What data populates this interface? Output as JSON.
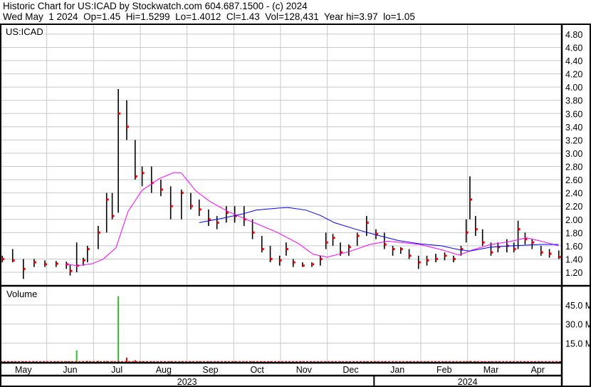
{
  "header": {
    "title": "Historic Chart for US:ICAD by Stockwatch.com 604.687.1500 - (c) 2024",
    "quote": "Wed May  1 2024  Op=1.45  Hi=1.5299  Lo=1.4012  Cl=1.43  Vol=128,431  Year hi=3.97  lo=1.05"
  },
  "colors": {
    "bar": "#000000",
    "close_tick": "#ff0000",
    "ma_short": "#ff00ff",
    "ma_long": "#0000ff",
    "vol_up": "#33bb33",
    "vol_down": "#ff0000",
    "grid": "#c8c8c8"
  },
  "chart_data": {
    "type": "ohlc",
    "symbol_label": "US:ICAD",
    "volume_label": "Volume",
    "x_unit": "months since May 1 2023",
    "xlim": [
      0,
      12
    ],
    "ylim": [
      1.0,
      4.95
    ],
    "yticks": [
      "1.20",
      "1.40",
      "1.60",
      "1.80",
      "2.00",
      "2.20",
      "2.40",
      "2.60",
      "2.80",
      "3.00",
      "3.20",
      "3.40",
      "3.60",
      "3.80",
      "4.00",
      "4.20",
      "4.40",
      "4.60",
      "4.80"
    ],
    "vol_ylim": [
      0,
      60
    ],
    "vol_ticks": [
      "15.0 M",
      "30.0 M",
      "45.0 M"
    ],
    "months": [
      "May",
      "Jun",
      "Jul",
      "Aug",
      "Sep",
      "Oct",
      "Nov",
      "Dec",
      "Jan",
      "Feb",
      "Mar",
      "Apr"
    ],
    "years": [
      {
        "label": "2023",
        "from": 0,
        "to": 8
      },
      {
        "label": "2024",
        "from": 8,
        "to": 12
      }
    ],
    "bars": [
      [
        0.05,
        1.45,
        1.35,
        1.4,
        0.5
      ],
      [
        0.27,
        1.55,
        1.35,
        1.38,
        0.6
      ],
      [
        0.5,
        1.4,
        1.1,
        1.25,
        0.5
      ],
      [
        0.73,
        1.4,
        1.28,
        1.35,
        0.5
      ],
      [
        0.96,
        1.38,
        1.28,
        1.32,
        0.4
      ],
      [
        1.2,
        1.37,
        1.28,
        1.33,
        0.4
      ],
      [
        1.42,
        1.36,
        1.25,
        1.32,
        0.5
      ],
      [
        1.5,
        1.32,
        1.15,
        1.22,
        0.5
      ],
      [
        1.64,
        1.65,
        1.2,
        1.3,
        9.2
      ],
      [
        1.78,
        1.42,
        1.3,
        1.38,
        0.8
      ],
      [
        1.87,
        1.6,
        1.35,
        1.55,
        1.0
      ],
      [
        2.1,
        1.9,
        1.55,
        1.8,
        1.1
      ],
      [
        2.28,
        2.4,
        1.8,
        2.3,
        0.9
      ],
      [
        2.4,
        2.4,
        2.0,
        2.05,
        0.8
      ],
      [
        2.53,
        3.97,
        2.1,
        3.6,
        52.0
      ],
      [
        2.71,
        3.8,
        3.2,
        3.4,
        3.5
      ],
      [
        2.89,
        3.2,
        2.6,
        2.65,
        1.5
      ],
      [
        3.04,
        2.8,
        2.5,
        2.7,
        0.7
      ],
      [
        3.24,
        2.8,
        2.4,
        2.55,
        0.6
      ],
      [
        3.44,
        2.6,
        2.35,
        2.45,
        0.7
      ],
      [
        3.65,
        2.5,
        2.0,
        2.2,
        0.6
      ],
      [
        3.88,
        2.45,
        2.0,
        2.4,
        0.5
      ],
      [
        4.08,
        2.4,
        2.15,
        2.2,
        0.5
      ],
      [
        4.26,
        2.3,
        2.05,
        2.15,
        0.5
      ],
      [
        4.46,
        2.15,
        1.9,
        2.0,
        0.5
      ],
      [
        4.64,
        2.05,
        1.85,
        1.95,
        0.4
      ],
      [
        4.84,
        2.2,
        1.95,
        2.1,
        0.5
      ],
      [
        5.02,
        2.2,
        1.95,
        2.05,
        0.5
      ],
      [
        5.22,
        2.2,
        1.9,
        2.0,
        0.5
      ],
      [
        5.4,
        2.0,
        1.7,
        1.8,
        0.5
      ],
      [
        5.6,
        1.75,
        1.5,
        1.55,
        0.5
      ],
      [
        5.78,
        1.6,
        1.35,
        1.4,
        0.5
      ],
      [
        5.98,
        1.45,
        1.3,
        1.38,
        0.4
      ],
      [
        6.12,
        1.65,
        1.45,
        1.55,
        0.5
      ],
      [
        6.27,
        1.4,
        1.28,
        1.35,
        0.4
      ],
      [
        6.47,
        1.35,
        1.28,
        1.3,
        0.4
      ],
      [
        6.67,
        1.35,
        1.28,
        1.32,
        0.4
      ],
      [
        6.85,
        1.45,
        1.3,
        1.4,
        0.4
      ],
      [
        6.97,
        1.8,
        1.55,
        1.65,
        0.6
      ],
      [
        7.12,
        1.78,
        1.6,
        1.72,
        0.5
      ],
      [
        7.28,
        1.65,
        1.45,
        1.5,
        0.5
      ],
      [
        7.46,
        1.62,
        1.45,
        1.58,
        0.4
      ],
      [
        7.64,
        1.8,
        1.6,
        1.75,
        0.5
      ],
      [
        7.84,
        2.05,
        1.75,
        1.95,
        0.6
      ],
      [
        8.04,
        1.85,
        1.7,
        1.78,
        0.5
      ],
      [
        8.22,
        1.8,
        1.55,
        1.62,
        0.5
      ],
      [
        8.4,
        1.6,
        1.45,
        1.55,
        0.4
      ],
      [
        8.57,
        1.58,
        1.48,
        1.55,
        0.4
      ],
      [
        8.75,
        1.55,
        1.4,
        1.45,
        0.4
      ],
      [
        8.95,
        1.45,
        1.25,
        1.35,
        0.5
      ],
      [
        9.13,
        1.45,
        1.3,
        1.38,
        0.4
      ],
      [
        9.32,
        1.48,
        1.35,
        1.4,
        0.4
      ],
      [
        9.51,
        1.5,
        1.38,
        1.45,
        0.4
      ],
      [
        9.7,
        1.45,
        1.35,
        1.4,
        0.4
      ],
      [
        9.86,
        1.6,
        1.45,
        1.55,
        0.5
      ],
      [
        9.97,
        2.0,
        1.65,
        1.8,
        0.8
      ],
      [
        10.05,
        2.65,
        2.0,
        2.3,
        1.0
      ],
      [
        10.17,
        2.05,
        1.75,
        1.85,
        0.6
      ],
      [
        10.32,
        1.85,
        1.6,
        1.65,
        0.5
      ],
      [
        10.5,
        1.65,
        1.45,
        1.5,
        0.4
      ],
      [
        10.65,
        1.65,
        1.5,
        1.58,
        0.4
      ],
      [
        10.84,
        1.7,
        1.5,
        1.6,
        0.4
      ],
      [
        10.99,
        1.65,
        1.5,
        1.55,
        0.4
      ],
      [
        11.08,
        1.98,
        1.55,
        1.85,
        0.6
      ],
      [
        11.23,
        1.8,
        1.62,
        1.7,
        0.5
      ],
      [
        11.38,
        1.7,
        1.55,
        1.65,
        0.4
      ],
      [
        11.57,
        1.6,
        1.45,
        1.5,
        0.4
      ],
      [
        11.75,
        1.55,
        1.42,
        1.48,
        0.4
      ],
      [
        11.95,
        1.53,
        1.4,
        1.43,
        0.13
      ]
    ],
    "ma_short": [
      [
        1.4,
        1.32
      ],
      [
        1.67,
        1.3
      ],
      [
        1.98,
        1.33
      ],
      [
        2.21,
        1.4
      ],
      [
        2.48,
        1.57
      ],
      [
        2.74,
        2.12
      ],
      [
        3.04,
        2.44
      ],
      [
        3.42,
        2.62
      ],
      [
        3.73,
        2.71
      ],
      [
        3.88,
        2.7
      ],
      [
        4.19,
        2.43
      ],
      [
        4.49,
        2.27
      ],
      [
        4.87,
        2.12
      ],
      [
        5.33,
        1.98
      ],
      [
        5.94,
        1.8
      ],
      [
        6.39,
        1.63
      ],
      [
        6.7,
        1.47
      ],
      [
        7.0,
        1.43
      ],
      [
        7.46,
        1.51
      ],
      [
        7.91,
        1.62
      ],
      [
        8.3,
        1.67
      ],
      [
        8.98,
        1.62
      ],
      [
        9.44,
        1.54
      ],
      [
        9.82,
        1.46
      ],
      [
        10.12,
        1.54
      ],
      [
        10.5,
        1.62
      ],
      [
        10.88,
        1.66
      ],
      [
        11.26,
        1.72
      ],
      [
        11.57,
        1.67
      ],
      [
        11.95,
        1.6
      ]
    ],
    "ma_long": [
      [
        4.26,
        1.95
      ],
      [
        4.72,
        2.01
      ],
      [
        5.18,
        2.08
      ],
      [
        5.48,
        2.14
      ],
      [
        5.94,
        2.17
      ],
      [
        6.16,
        2.18
      ],
      [
        6.54,
        2.14
      ],
      [
        6.85,
        2.06
      ],
      [
        7.15,
        1.95
      ],
      [
        7.61,
        1.85
      ],
      [
        8.07,
        1.76
      ],
      [
        8.52,
        1.68
      ],
      [
        8.98,
        1.63
      ],
      [
        9.44,
        1.6
      ],
      [
        9.82,
        1.54
      ],
      [
        10.05,
        1.52
      ],
      [
        10.5,
        1.58
      ],
      [
        10.96,
        1.6
      ],
      [
        11.57,
        1.62
      ],
      [
        11.95,
        1.62
      ]
    ]
  }
}
